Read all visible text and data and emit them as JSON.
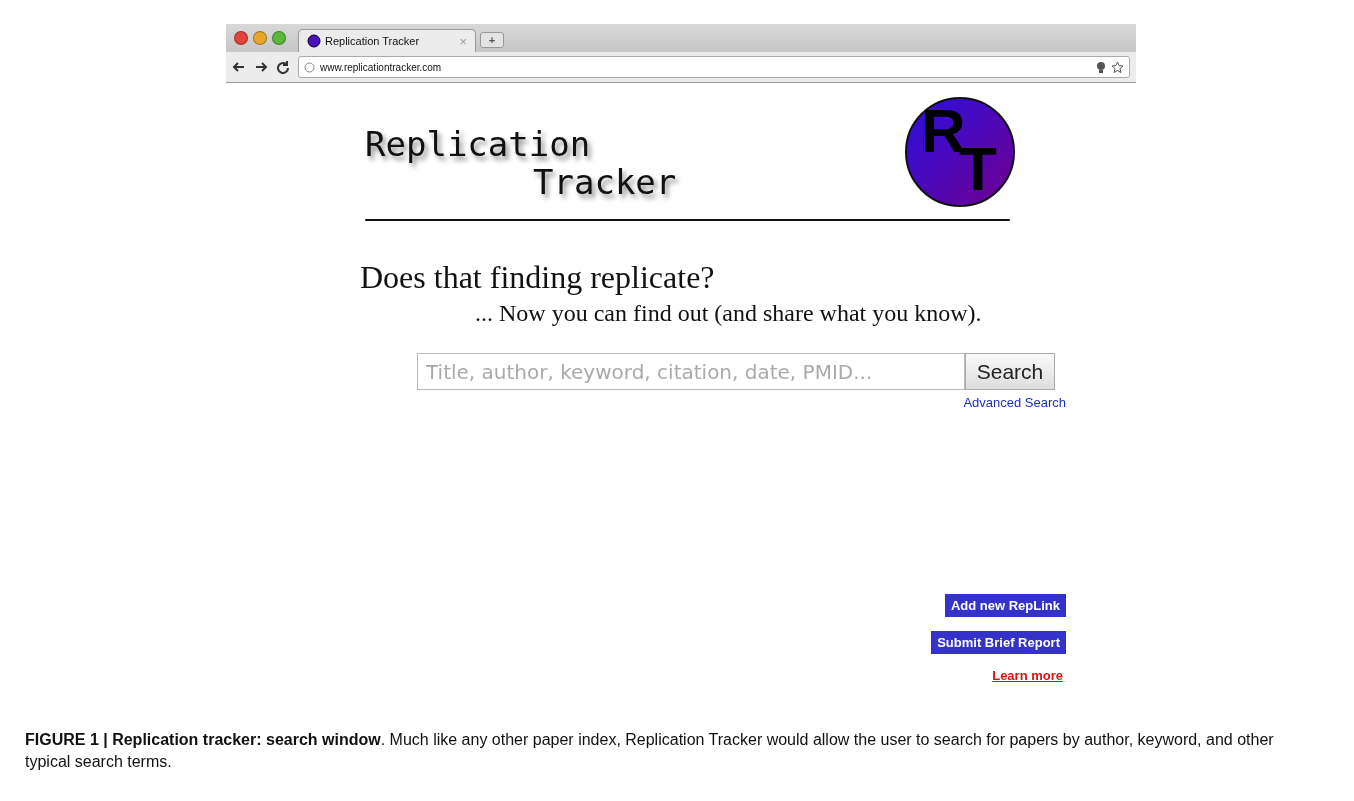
{
  "browser": {
    "tab_title": "Replication Tracker",
    "url": "www.replicationtracker.com",
    "new_tab": "+",
    "close": "×"
  },
  "header": {
    "title_lines": [
      "Replication",
      "Tracker"
    ],
    "logo_letters": [
      "R",
      "T"
    ]
  },
  "tagline": {
    "heading": "Does that finding replicate?",
    "subheading": "... Now you can find out (and share what you know)."
  },
  "search": {
    "placeholder": "Title, author, keyword, citation, date, PMID...",
    "button": "Search",
    "advanced_link": "Advanced Search"
  },
  "actions": [
    {
      "label": "Add new RepLink",
      "kind": "button"
    },
    {
      "label": "Submit Brief Report",
      "kind": "button"
    },
    {
      "label": "Learn more",
      "kind": "link"
    }
  ],
  "caption": "**FIGURE 1 | Replication tracker: search window**. Much like any other paper index, Replication Tracker would allow the user to search for papers by author, keyword, and other typical search terms."
}
